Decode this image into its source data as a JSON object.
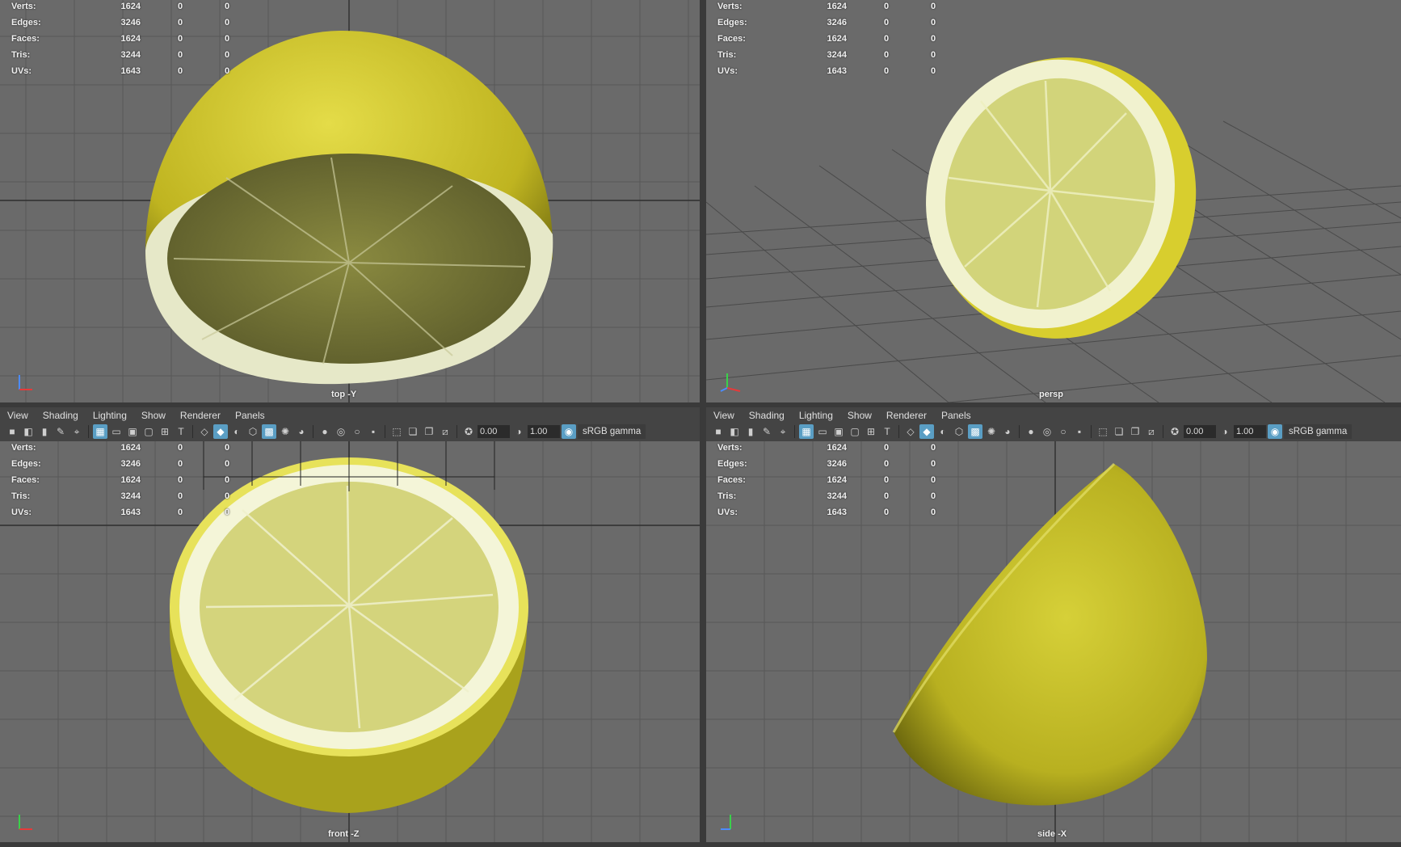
{
  "hud": {
    "labels": [
      "Verts:",
      "Edges:",
      "Faces:",
      "Tris:",
      "UVs:"
    ],
    "rows": [
      [
        "1624",
        "0",
        "0"
      ],
      [
        "3246",
        "0",
        "0"
      ],
      [
        "1624",
        "0",
        "0"
      ],
      [
        "3244",
        "0",
        "0"
      ],
      [
        "1643",
        "0",
        "0"
      ]
    ]
  },
  "cameras": {
    "top": "top -Y",
    "persp": "persp",
    "front": "front -Z",
    "side": "side -X"
  },
  "menu": [
    "View",
    "Shading",
    "Lighting",
    "Show",
    "Renderer",
    "Panels"
  ],
  "toolbar": {
    "exposure": "0.00",
    "gamma": "1.00",
    "color_space": "sRGB gamma"
  },
  "colors": {
    "viewport_bg": "#6a6a6a",
    "grid": "#555555",
    "lemon_peel": "#c9c12a",
    "lemon_pith": "#eef0c8",
    "lemon_flesh": "#c9cd6a",
    "active_icon": "#5a9ec4"
  }
}
